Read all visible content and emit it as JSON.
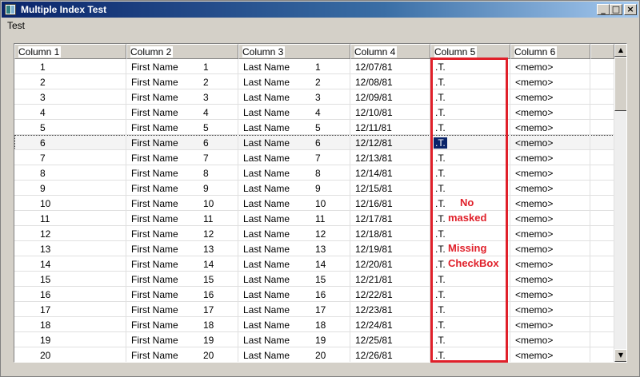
{
  "window": {
    "title": "Multiple Index Test"
  },
  "menu": {
    "items": [
      "Test"
    ]
  },
  "columns": [
    "Column 1",
    "Column 2",
    "Column 3",
    "Column 4",
    "Column 5",
    "Column 6"
  ],
  "rows": [
    [
      "1",
      "First Name",
      "1",
      "Last Name",
      "1",
      "12/07/81",
      ".T.",
      "<memo>"
    ],
    [
      "2",
      "First Name",
      "2",
      "Last Name",
      "2",
      "12/08/81",
      ".T.",
      "<memo>"
    ],
    [
      "3",
      "First Name",
      "3",
      "Last Name",
      "3",
      "12/09/81",
      ".T.",
      "<memo>"
    ],
    [
      "4",
      "First Name",
      "4",
      "Last Name",
      "4",
      "12/10/81",
      ".T.",
      "<memo>"
    ],
    [
      "5",
      "First Name",
      "5",
      "Last Name",
      "5",
      "12/11/81",
      ".T.",
      "<memo>"
    ],
    [
      "6",
      "First Name",
      "6",
      "Last Name",
      "6",
      "12/12/81",
      ".T.",
      "<memo>"
    ],
    [
      "7",
      "First Name",
      "7",
      "Last Name",
      "7",
      "12/13/81",
      ".T.",
      "<memo>"
    ],
    [
      "8",
      "First Name",
      "8",
      "Last Name",
      "8",
      "12/14/81",
      ".T.",
      "<memo>"
    ],
    [
      "9",
      "First Name",
      "9",
      "Last Name",
      "9",
      "12/15/81",
      ".T.",
      "<memo>"
    ],
    [
      "10",
      "First Name",
      "10",
      "Last Name",
      "10",
      "12/16/81",
      ".T.",
      "<memo>"
    ],
    [
      "11",
      "First Name",
      "11",
      "Last Name",
      "11",
      "12/17/81",
      ".T.",
      "<memo>"
    ],
    [
      "12",
      "First Name",
      "12",
      "Last Name",
      "12",
      "12/18/81",
      ".T.",
      "<memo>"
    ],
    [
      "13",
      "First Name",
      "13",
      "Last Name",
      "13",
      "12/19/81",
      ".T.",
      "<memo>"
    ],
    [
      "14",
      "First Name",
      "14",
      "Last Name",
      "14",
      "12/20/81",
      ".T.",
      "<memo>"
    ],
    [
      "15",
      "First Name",
      "15",
      "Last Name",
      "15",
      "12/21/81",
      ".T.",
      "<memo>"
    ],
    [
      "16",
      "First Name",
      "16",
      "Last Name",
      "16",
      "12/22/81",
      ".T.",
      "<memo>"
    ],
    [
      "17",
      "First Name",
      "17",
      "Last Name",
      "17",
      "12/23/81",
      ".T.",
      "<memo>"
    ],
    [
      "18",
      "First Name",
      "18",
      "Last Name",
      "18",
      "12/24/81",
      ".T.",
      "<memo>"
    ],
    [
      "19",
      "First Name",
      "19",
      "Last Name",
      "19",
      "12/25/81",
      ".T.",
      "<memo>"
    ],
    [
      "20",
      "First Name",
      "20",
      "Last Name",
      "20",
      "12/26/81",
      ".T.",
      "<memo>"
    ]
  ],
  "selected_row": 6,
  "annotations": {
    "note1_line1": "No",
    "note1_line2": "masked",
    "note2_line1": "Missing",
    "note2_line2": "CheckBox",
    "color": "#e0202a"
  },
  "icons": {
    "app": "app-window-icon",
    "minimize": "minimize-icon",
    "maximize": "maximize-icon",
    "close": "close-icon",
    "scroll_up": "arrow-up-icon",
    "scroll_down": "arrow-down-icon"
  },
  "colors": {
    "titlebar": "#0a246a",
    "selection": "#0a246a",
    "chrome": "#d4d0c8"
  }
}
